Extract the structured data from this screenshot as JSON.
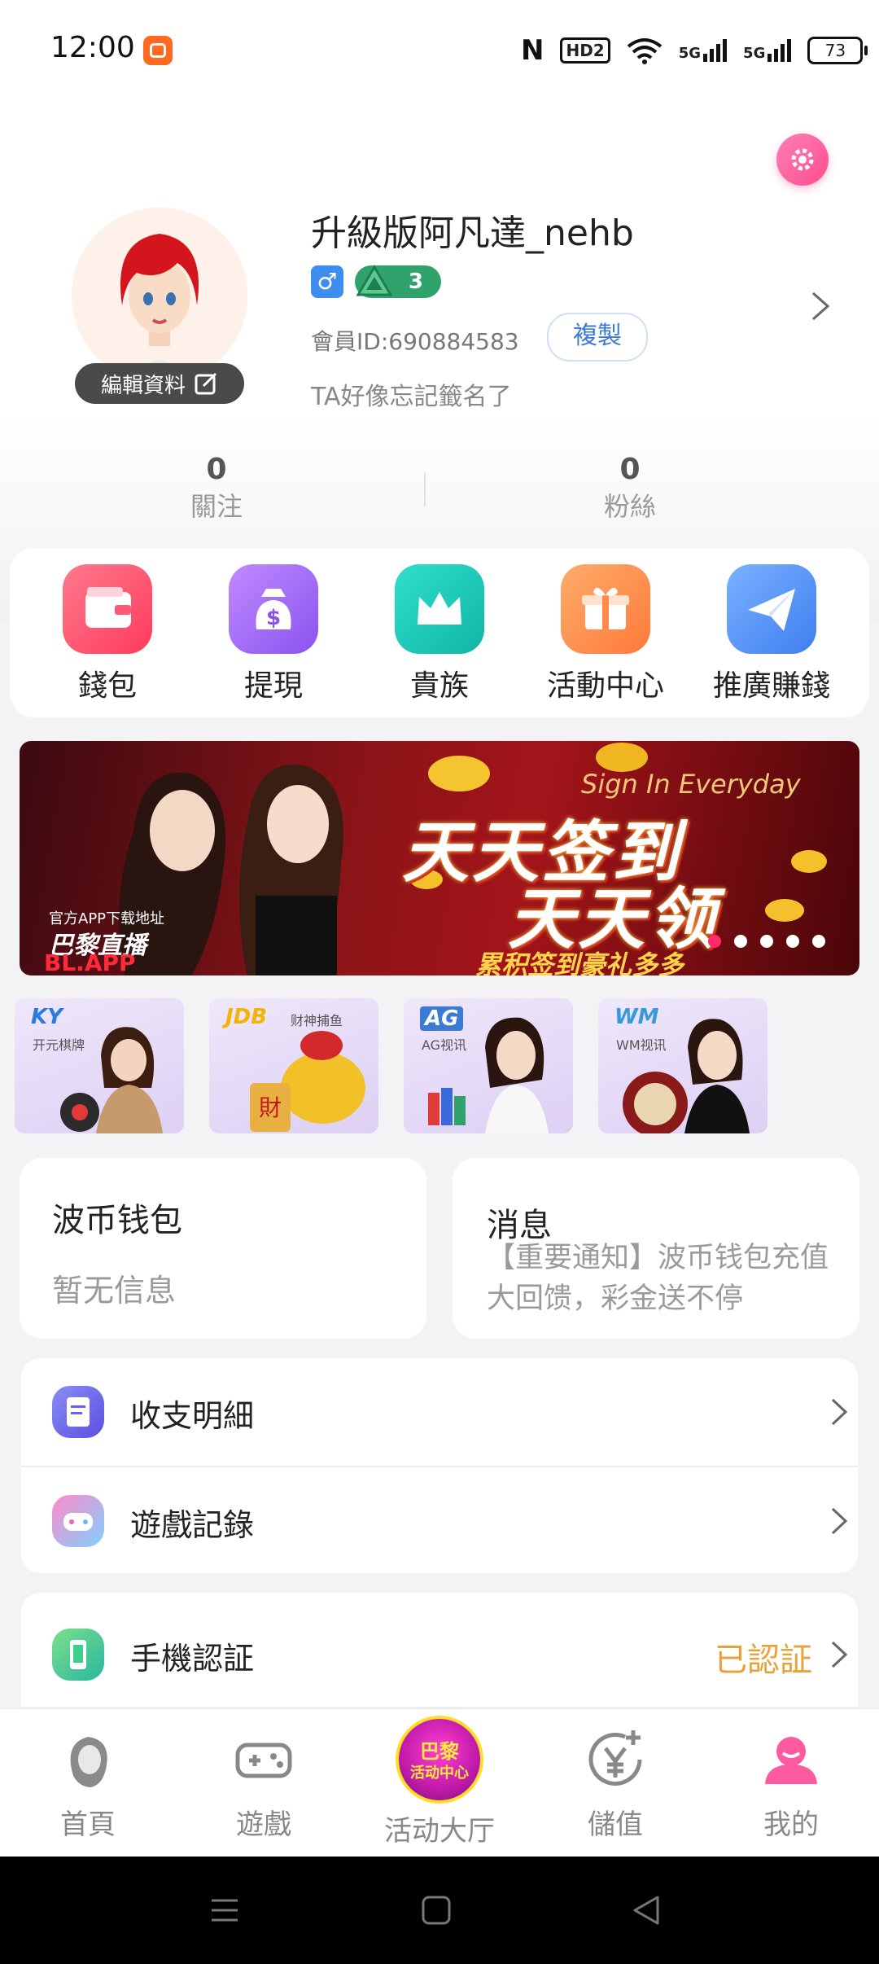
{
  "status_bar": {
    "time": "12:00",
    "hd_label": "HD2",
    "signal1_label": "5G",
    "signal2_label": "5G",
    "battery": "73",
    "icons": [
      "app-notification-icon",
      "nfc-icon",
      "hd-voice-icon",
      "wifi-icon",
      "signal-5g-icon",
      "signal-5g-icon",
      "battery-icon"
    ]
  },
  "profile": {
    "username": "升級版阿凡達_nehb",
    "gender_symbol": "♂",
    "level": "3",
    "member_id": "會員ID:690884583",
    "copy_label": "複製",
    "signature": "TA好像忘記籤名了",
    "edit_label": "編輯資料",
    "stats": [
      {
        "value": "0",
        "label": "關注"
      },
      {
        "value": "0",
        "label": "粉絲"
      }
    ]
  },
  "quick_actions": [
    {
      "label": "錢包",
      "icon": "wallet-icon",
      "color": "#ff4f6e"
    },
    {
      "label": "提現",
      "icon": "money-bag-icon",
      "color": "#a56af5"
    },
    {
      "label": "貴族",
      "icon": "crown-icon",
      "color": "#18c8b5"
    },
    {
      "label": "活動中心",
      "icon": "gift-icon",
      "color": "#ff8a4a"
    },
    {
      "label": "推廣賺錢",
      "icon": "paper-plane-icon",
      "color": "#4d8ef5"
    }
  ],
  "banner": {
    "script_text": "Sign In Everyday",
    "headline1": "天天签到",
    "headline2": "天天领",
    "subline": "累积签到豪礼多多",
    "brand_line1": "官方APP下载地址",
    "brand_line2": "巴黎直播",
    "brand_line3": "BL.APP",
    "slides_total": 5,
    "active_slide": 1
  },
  "game_tiles": [
    {
      "logo": "KY",
      "sub": "开元棋牌",
      "logo_color": "#2a7be0"
    },
    {
      "logo": "JDB",
      "sub": "财神捕鱼",
      "logo_color": "#f2b400"
    },
    {
      "logo": "AG",
      "sub": "AG视讯",
      "logo_color": "#3a7bd5"
    },
    {
      "logo": "WM",
      "sub": "WM视讯",
      "logo_color": "#3a9ad9"
    }
  ],
  "wallet_card": {
    "title": "波币钱包",
    "body": "暂无信息"
  },
  "message_card": {
    "title": "消息",
    "body": "【重要通知】波币钱包充值大回馈，彩金送不停"
  },
  "list_rows": [
    {
      "label": "收支明細"
    },
    {
      "label": "遊戲記錄"
    },
    {
      "label": "手機認証",
      "status": "已認証"
    }
  ],
  "bottom_nav": [
    {
      "label": "首頁",
      "icon": "home-lady-icon"
    },
    {
      "label": "遊戲",
      "icon": "gamepad-icon"
    },
    {
      "label": "活动大厅",
      "icon": "activity-center-badge",
      "badge_line1": "巴黎",
      "badge_line2": "活动中心"
    },
    {
      "label": "儲值",
      "icon": "yuan-plus-icon"
    },
    {
      "label": "我的",
      "icon": "profile-icon",
      "active": true
    }
  ]
}
